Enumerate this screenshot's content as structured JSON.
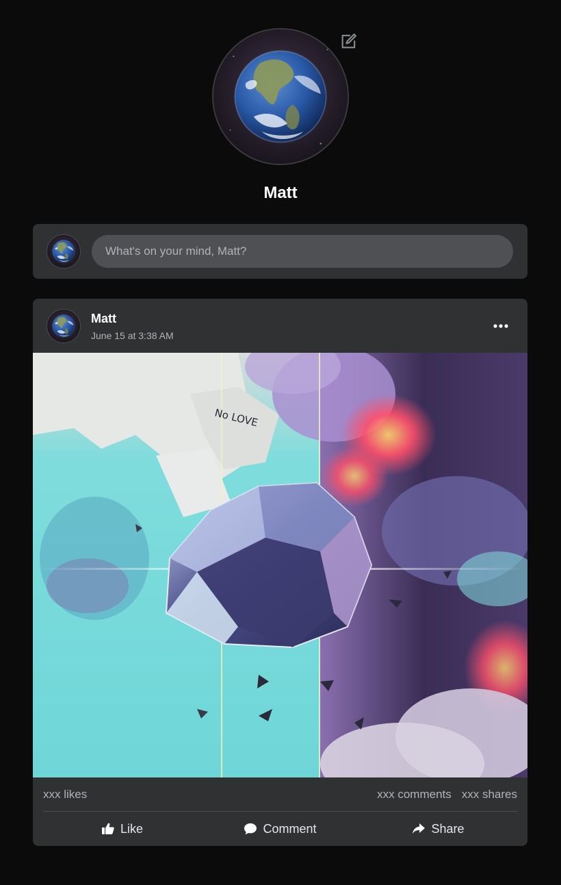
{
  "profile": {
    "name": "Matt",
    "picture": "earth-globe",
    "edit_icon": "edit-icon"
  },
  "composer": {
    "placeholder": "What's on your mind, Matt?"
  },
  "post": {
    "author": "Matt",
    "timestamp": "June 15 at 3:38 AM",
    "image_text": "No LOVE",
    "stats": {
      "likes": "xxx likes",
      "comments": "xxx comments",
      "shares": "xxx shares"
    },
    "actions": {
      "like": "Like",
      "comment": "Comment",
      "share": "Share"
    }
  },
  "colors": {
    "background": "#0b0b0b",
    "card": "#2f3133",
    "input": "#4e5053",
    "text": "#e4e6eb",
    "muted": "#b0b3b8"
  }
}
